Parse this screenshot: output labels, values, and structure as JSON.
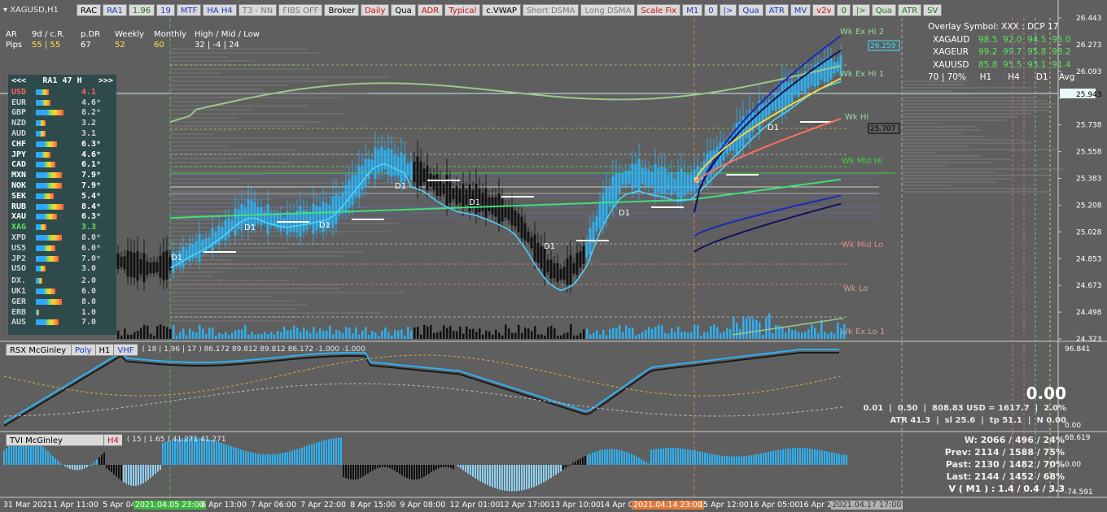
{
  "window": {
    "symbol_label": "XAGUSD,H1"
  },
  "toolbar": [
    {
      "label": "RAC",
      "color": "#000000"
    },
    {
      "label": "RA1",
      "color": "#1a3cc8"
    },
    {
      "label": "1.96",
      "color": "#1a7a1a"
    },
    {
      "label": "19",
      "color": "#1a3cc8"
    },
    {
      "label": "MTF",
      "color": "#1a3cc8"
    },
    {
      "label": "HA H4",
      "color": "#1a3cc8"
    },
    {
      "label": "T3 - NN",
      "color": "#7a7a7a"
    },
    {
      "label": "FIBS OFF",
      "color": "#7a7a7a"
    },
    {
      "label": "Broker",
      "color": "#000000"
    },
    {
      "label": "Daily",
      "color": "#d01010"
    },
    {
      "label": "Qua",
      "color": "#000000"
    },
    {
      "label": "ADR",
      "color": "#d01010"
    },
    {
      "label": "Typical",
      "color": "#d01010"
    },
    {
      "label": "c.VWAP",
      "color": "#000000"
    },
    {
      "label": "Short DSMA",
      "color": "#7a7a7a"
    },
    {
      "label": "Long DSMA",
      "color": "#7a7a7a"
    },
    {
      "label": "Scale Fix",
      "color": "#d01010"
    },
    {
      "label": "M1",
      "color": "#1a3cc8"
    },
    {
      "label": "0",
      "color": "#1a3cc8"
    },
    {
      "label": "|>",
      "color": "#1a3cc8"
    },
    {
      "label": "Qua",
      "color": "#1a3cc8"
    },
    {
      "label": "ATR",
      "color": "#1a3cc8"
    },
    {
      "label": "MV",
      "color": "#1a3cc8"
    },
    {
      "label": "v2v",
      "color": "#d01010"
    },
    {
      "label": "0",
      "color": "#1a7a1a"
    },
    {
      "label": "|>",
      "color": "#1a7a1a"
    },
    {
      "label": "Qua",
      "color": "#1a7a1a"
    },
    {
      "label": "ATR",
      "color": "#1a7a1a"
    },
    {
      "label": "SV",
      "color": "#1a7a1a"
    }
  ],
  "ar_panel": {
    "row1": [
      "AR",
      "9d / c.R.",
      "p.DR",
      "Weekly",
      "Monthly",
      "High / Mid / Low"
    ],
    "row2": [
      "Pips",
      "55 | 55",
      "67",
      "52",
      "60",
      "32 | -4 | 24"
    ]
  },
  "currency_panel": {
    "prev": "<<<",
    "title": "RA1  47  H",
    "next": ">>>",
    "items": [
      {
        "name": "USD",
        "value": "4.1",
        "star": "",
        "color": "#ff6060",
        "bar": 0.4
      },
      {
        "name": "EUR",
        "value": "4.6",
        "star": "*",
        "color": "#cfcfcf",
        "bar": 0.45
      },
      {
        "name": "GBP",
        "value": "8.2",
        "star": "*",
        "color": "#cfcfcf",
        "bar": 0.85
      },
      {
        "name": "NZD",
        "value": "3.2",
        "star": "",
        "color": "#cfcfcf",
        "bar": 0.3
      },
      {
        "name": "AUD",
        "value": "3.1",
        "star": "",
        "color": "#cfcfcf",
        "bar": 0.3
      },
      {
        "name": "CHF",
        "value": "6.3",
        "star": "*",
        "color": "#ffffff",
        "bar": 0.65
      },
      {
        "name": "JPY",
        "value": "4.6",
        "star": "*",
        "color": "#ffffff",
        "bar": 0.45
      },
      {
        "name": "CAD",
        "value": "6.1",
        "star": "*",
        "color": "#ffffff",
        "bar": 0.6
      },
      {
        "name": "MXN",
        "value": "7.9",
        "star": "*",
        "color": "#ffffff",
        "bar": 0.8
      },
      {
        "name": "NOK",
        "value": "7.9",
        "star": "*",
        "color": "#ffffff",
        "bar": 0.8
      },
      {
        "name": "SEK",
        "value": "5.4",
        "star": "*",
        "color": "#ffffff",
        "bar": 0.55
      },
      {
        "name": "RUB",
        "value": "8.4",
        "star": "*",
        "color": "#ffffff",
        "bar": 0.85
      },
      {
        "name": "XAU",
        "value": "6.3",
        "star": "*",
        "color": "#ffffff",
        "bar": 0.65
      },
      {
        "name": "XAG",
        "value": "3.3",
        "star": "",
        "color": "#5fe05f",
        "bar": 0.33
      },
      {
        "name": "XPD",
        "value": "8.0",
        "star": "*",
        "color": "#cfcfcf",
        "bar": 0.8
      },
      {
        "name": "US5",
        "value": "6.0",
        "star": "*",
        "color": "#cfcfcf",
        "bar": 0.6
      },
      {
        "name": "JP2",
        "value": "7.0",
        "star": "*",
        "color": "#cfcfcf",
        "bar": 0.7
      },
      {
        "name": "USO",
        "value": "3.0",
        "star": "",
        "color": "#cfcfcf",
        "bar": 0.3
      },
      {
        "name": "DX.",
        "value": "2.0",
        "star": "",
        "color": "#cfcfcf",
        "bar": 0.2
      },
      {
        "name": "UK1",
        "value": "6.0",
        "star": "",
        "color": "#cfcfcf",
        "bar": 0.6
      },
      {
        "name": "GER",
        "value": "8.0",
        "star": "",
        "color": "#cfcfcf",
        "bar": 0.8
      },
      {
        "name": "ERB",
        "value": "1.0",
        "star": "",
        "color": "#cfcfcf",
        "bar": 0.1
      },
      {
        "name": "AUS",
        "value": "7.0",
        "star": "",
        "color": "#cfcfcf",
        "bar": 0.7
      }
    ]
  },
  "overlay_symbols": {
    "title": "Overlay Symbol: XXX : DCP 17",
    "rows": [
      {
        "sym": "XAGAUD",
        "values": "98.5  92.0  94.5  95.0"
      },
      {
        "sym": "XAGEUR",
        "values": "99.2  99.7  95.8  98.2"
      },
      {
        "sym": "XAUUSD",
        "values": "85.8  95.5  93.1  91.4"
      }
    ],
    "footer": "70 | 70%     H1      H4      D1    Avg"
  },
  "price_axis": [
    "26.443",
    "26.273",
    "26.093",
    "25.943",
    "25.738",
    "25.558",
    "25.383",
    "25.208",
    "25.028",
    "24.853",
    "24.673",
    "24.498",
    "24.323"
  ],
  "current_price": "25.943",
  "level_labels": {
    "wk_ex_hi_2": "Wk Ex Hi 2",
    "wk_ex_hi_2_price": "26.259",
    "wk_ex_hi_1": "Wk Ex Hi 1",
    "wk_hi": "Wk Hi",
    "wk_hi_price": "25.707",
    "wk_mid_hi": "Wk Mid Hi",
    "wk_mid_lo": "Wk Mid Lo",
    "wk_lo": "Wk Lo",
    "wk_ex_lo_1": "Wk Ex Lo 1"
  },
  "d1_label": "D1",
  "rsx_panel": {
    "buttons": [
      "RSX McGinley",
      "Poly",
      "H1",
      "VHF"
    ],
    "params": "( 18 | 1.96 | 17 ) 86.172 89.812 89.812 86.172 -1.000 -1.000",
    "axis_top": "96.841",
    "axis_bottom": "0.00",
    "big_value": "0.00",
    "line1": "0.01  |  0.50  |  808.83 USD = 1617.7  |  2.0%",
    "line2": "ATR 41.3  |  sl 25.6  |  tp 51.1  |  N 0.00"
  },
  "tvi_panel": {
    "buttons": [
      "TVI McGinley",
      "H4"
    ],
    "params": "( 15 | 1.65 ) 41.271 41.271",
    "axis": [
      "68.619",
      "0.00",
      "-74.591"
    ],
    "stats": [
      "W: 2066 / 496 / 24%",
      "Prev: 2114 / 1588 / 75%",
      "Past: 2130 / 1482 / 70%",
      "Last: 2144 / 1452 / 68%",
      "V ( M1 ) : 1.4 / 0.4 / 3.3"
    ]
  },
  "time_axis": [
    {
      "label": "31 Mar 2021",
      "x": 0.003
    },
    {
      "label": "1 Apr 11:00",
      "x": 0.05
    },
    {
      "label": "5 Apr 04",
      "x": 0.097
    },
    {
      "label": "2021.04.05 23:00",
      "x": 0.126,
      "hl": "#3db83d"
    },
    {
      "label": "6 Apr 13:00",
      "x": 0.19
    },
    {
      "label": "7 Apr 06:00",
      "x": 0.237
    },
    {
      "label": "7 Apr 22:00",
      "x": 0.284
    },
    {
      "label": "8 Apr 15:00",
      "x": 0.331
    },
    {
      "label": "9 Apr 08:00",
      "x": 0.378
    },
    {
      "label": "12 Apr 01:00",
      "x": 0.425
    },
    {
      "label": "12 Apr 17:00",
      "x": 0.472
    },
    {
      "label": "13 Apr 10:00",
      "x": 0.52
    },
    {
      "label": "14 Apr 03",
      "x": 0.567
    },
    {
      "label": "2021.04.14 23:00",
      "x": 0.597,
      "hl": "#e07a3a"
    },
    {
      "label": "15 Apr 12:00",
      "x": 0.66
    },
    {
      "label": "16 Apr 05:00",
      "x": 0.708
    },
    {
      "label": "16 Apr 21",
      "x": 0.755
    },
    {
      "label": "2021.04.17 17:00",
      "x": 0.785,
      "hl": "#b0b0b0"
    }
  ]
}
